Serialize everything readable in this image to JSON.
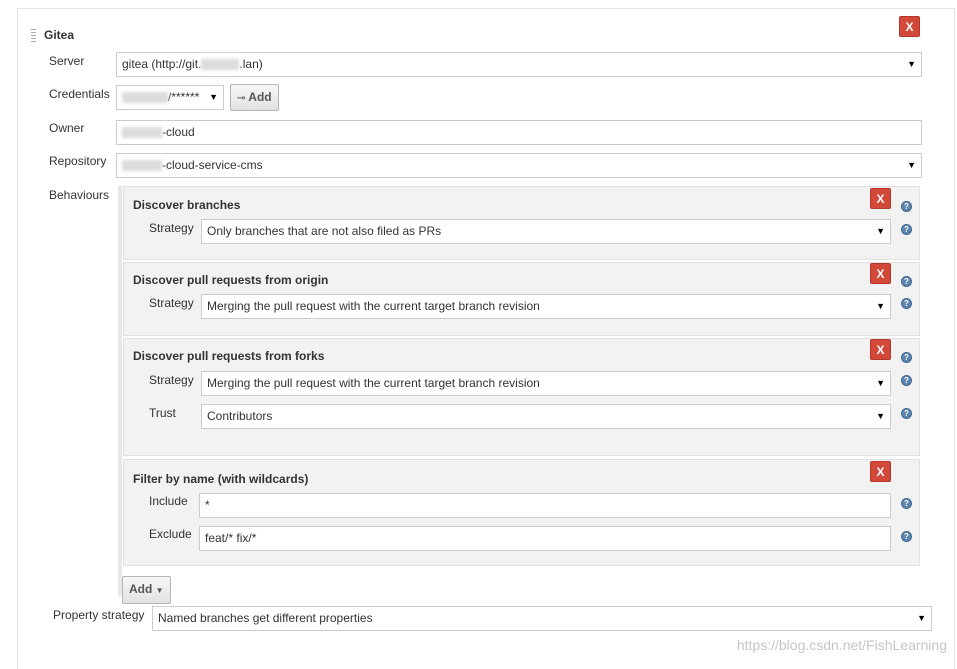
{
  "section": {
    "title": "Gitea",
    "remove_label": "X"
  },
  "server": {
    "label": "Server",
    "value_prefix": "gitea (http://git.",
    "value_suffix": ".lan)"
  },
  "credentials": {
    "label": "Credentials",
    "value_suffix": "/******",
    "add_label": "Add",
    "add_icon": "key-icon"
  },
  "owner": {
    "label": "Owner",
    "value_suffix": "-cloud"
  },
  "repository": {
    "label": "Repository",
    "value_suffix": "-cloud-service-cms"
  },
  "behaviours": {
    "label": "Behaviours",
    "discover_branches": {
      "title": "Discover branches",
      "strategy_label": "Strategy",
      "strategy_value": "Only branches that are not also filed as PRs"
    },
    "discover_pr_origin": {
      "title": "Discover pull requests from origin",
      "strategy_label": "Strategy",
      "strategy_value": "Merging the pull request with the current target branch revision"
    },
    "discover_pr_forks": {
      "title": "Discover pull requests from forks",
      "strategy_label": "Strategy",
      "strategy_value": "Merging the pull request with the current target branch revision",
      "trust_label": "Trust",
      "trust_value": "Contributors"
    },
    "filter_by_name": {
      "title": "Filter by name (with wildcards)",
      "include_label": "Include",
      "include_value": "*",
      "exclude_label": "Exclude",
      "exclude_value": "feat/* fix/*"
    },
    "add_label": "Add"
  },
  "property_strategy": {
    "label": "Property strategy",
    "value": "Named branches get different properties"
  },
  "watermark": "https://blog.csdn.net/FishLearning",
  "colors": {
    "remove": "#d24939",
    "help": "#5b84b1"
  }
}
